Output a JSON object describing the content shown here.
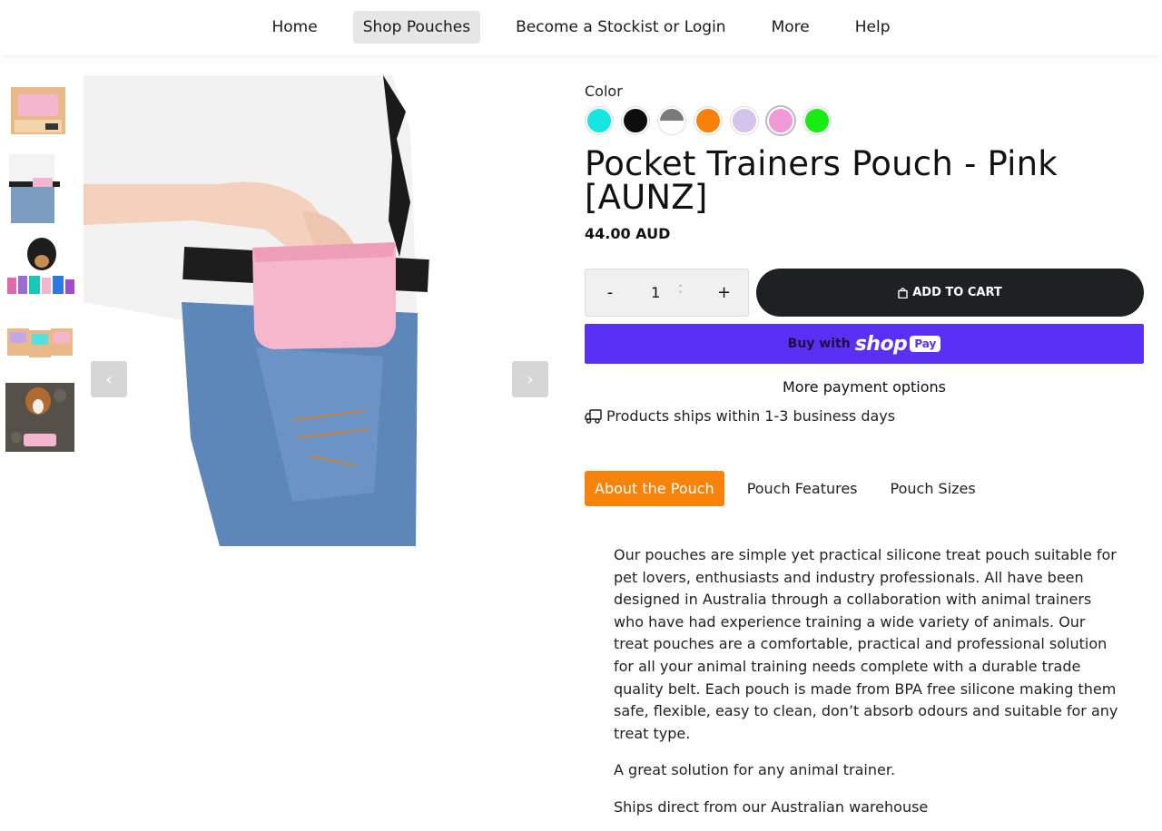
{
  "nav": {
    "items": [
      {
        "label": "Home",
        "active": false
      },
      {
        "label": "Shop Pouches",
        "active": true
      },
      {
        "label": "Become a Stockist or Login",
        "active": false
      },
      {
        "label": "More",
        "active": false
      },
      {
        "label": "Help",
        "active": false
      }
    ]
  },
  "gallery": {
    "prev_icon": "chevron-left-icon",
    "next_icon": "chevron-right-icon"
  },
  "product": {
    "color_label": "Color",
    "swatches": [
      "#15e6e2",
      "#0d0d0d",
      "#7b7b7b",
      "#f78107",
      "#d4c4ec",
      "#ef9ad6",
      "#19ec13"
    ],
    "selected_swatch": 5,
    "title": "Pocket Trainers Pouch - Pink [AUNZ]",
    "price": "44.00 AUD",
    "quantity": "1",
    "qty_minus": "-",
    "qty_plus": "+",
    "add_to_cart": "ADD TO CART",
    "shop_pay": {
      "buy_with": "Buy with",
      "shop": "shop",
      "pay": "Pay"
    },
    "more_payment": "More payment options",
    "shipping": "Products ships within 1-3 business days"
  },
  "tabs": [
    {
      "label": "About the Pouch",
      "active": true
    },
    {
      "label": "Pouch Features",
      "active": false
    },
    {
      "label": "Pouch Sizes",
      "active": false
    }
  ],
  "description": {
    "paragraphs": [
      "Our pouches are simple yet practical silicone treat pouch suitable for pet lovers, enthusiasts and industry professionals. All have been designed in Australia through a collaboration with animal trainers who have had experience training a wide variety of animals. Our treat pouches are a comfortable, practical and professional solution for all your animal training needs complete with a durable trade quality belt. Each pouch is made from BPA free silicone making them safe, flexible, easy to clean, don’t absorb odours and suitable for any treat type.",
      "A great solution for any animal trainer.",
      "Ships direct from our Australian warehouse"
    ]
  },
  "colors": {
    "accent_orange": "#f7830b",
    "shop_pay_purple": "#5a31f4",
    "cart_button": "#1e2122"
  }
}
